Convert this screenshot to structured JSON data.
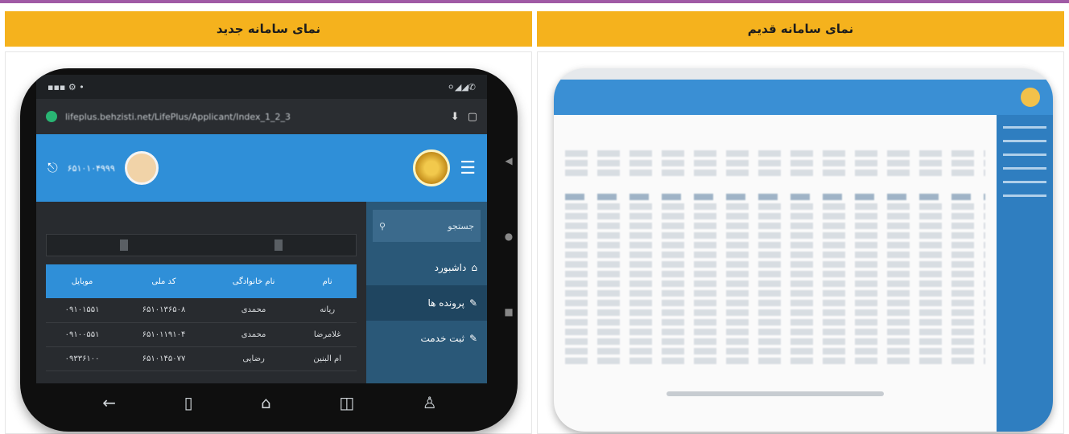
{
  "header_new": "نمای سامانه جدید",
  "header_old": "نمای سامانه قدیم",
  "new_system": {
    "status_time": "",
    "status_icons": "⚪◢◢✆",
    "url": "lifeplus.behzisti.net/LifePlus/Applicant/Index_1_2_3",
    "app_user_id": "۶۵۱۰۱۰۴۹۹۹",
    "search_placeholder": "جستجو",
    "sidebar": [
      "داشبورد",
      "پرونده ها",
      "ثبت خدمت"
    ],
    "table": {
      "headers": [
        "نام",
        "نام خانوادگی",
        "کد ملی",
        "موبایل"
      ],
      "rows": [
        [
          "ریانه",
          "محمدی",
          "۶۵۱۰۱۳۶۵۰۸",
          "۰۹۱۰۱۵۵۱"
        ],
        [
          "غلامرضا",
          "محمدی",
          "۶۵۱۰۱۱۹۱۰۴",
          "۰۹۱۰۰۵۵۱"
        ],
        [
          "ام البنین",
          "رضایی",
          "۶۵۱۰۱۴۵۰۷۷",
          "۰۹۳۳۶۱۰۰"
        ]
      ]
    }
  }
}
